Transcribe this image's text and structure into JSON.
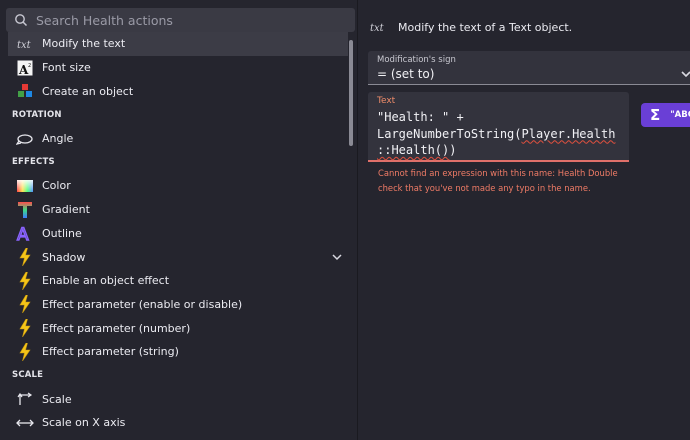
{
  "search": {
    "placeholder": "Search Health actions"
  },
  "list": {
    "items": [
      {
        "kind": "item",
        "label": "Modify the text",
        "icon": "txt-icon",
        "selected": true
      },
      {
        "kind": "item",
        "label": "Font size",
        "icon": "font-size-icon"
      },
      {
        "kind": "item",
        "label": "Create an object",
        "icon": "create-object-icon"
      },
      {
        "kind": "section",
        "label": "ROTATION"
      },
      {
        "kind": "item",
        "label": "Angle",
        "icon": "angle-icon"
      },
      {
        "kind": "section",
        "label": "EFFECTS"
      },
      {
        "kind": "item",
        "label": "Color",
        "icon": "color-icon"
      },
      {
        "kind": "item",
        "label": "Gradient",
        "icon": "gradient-icon"
      },
      {
        "kind": "item",
        "label": "Outline",
        "icon": "outline-icon"
      },
      {
        "kind": "item",
        "label": "Shadow",
        "icon": "lightning-icon",
        "expandable": true
      },
      {
        "kind": "item",
        "label": "Enable an object effect",
        "icon": "lightning-icon"
      },
      {
        "kind": "item",
        "label": "Effect parameter (enable or disable)",
        "icon": "lightning-icon"
      },
      {
        "kind": "item",
        "label": "Effect parameter (number)",
        "icon": "lightning-icon"
      },
      {
        "kind": "item",
        "label": "Effect parameter (string)",
        "icon": "lightning-icon"
      },
      {
        "kind": "section",
        "label": "SCALE"
      },
      {
        "kind": "item",
        "label": "Scale",
        "icon": "scale-icon"
      },
      {
        "kind": "item",
        "label": "Scale on X axis",
        "icon": "scale-x-icon"
      }
    ]
  },
  "action": {
    "description": "Modify the text of a Text object.",
    "modification_sign": {
      "label": "Modification's sign",
      "value": "= (set to)"
    },
    "text_param": {
      "label": "Text",
      "line1": "\"Health: \" +",
      "line2_plain": "LargeNumberToString(",
      "line2_err": "Player.Health",
      "line3_err": "::Health()",
      "line3_tail": ")"
    },
    "error": "Cannot find an expression with this name: Health Double check that you've not made any typo in the name.",
    "expression_button": {
      "symbol": "Σ",
      "label": "\"ABC"
    }
  },
  "colors": {
    "accent": "#6a3fd6",
    "error": "#ef7b66",
    "lightning": "#f5c518"
  }
}
